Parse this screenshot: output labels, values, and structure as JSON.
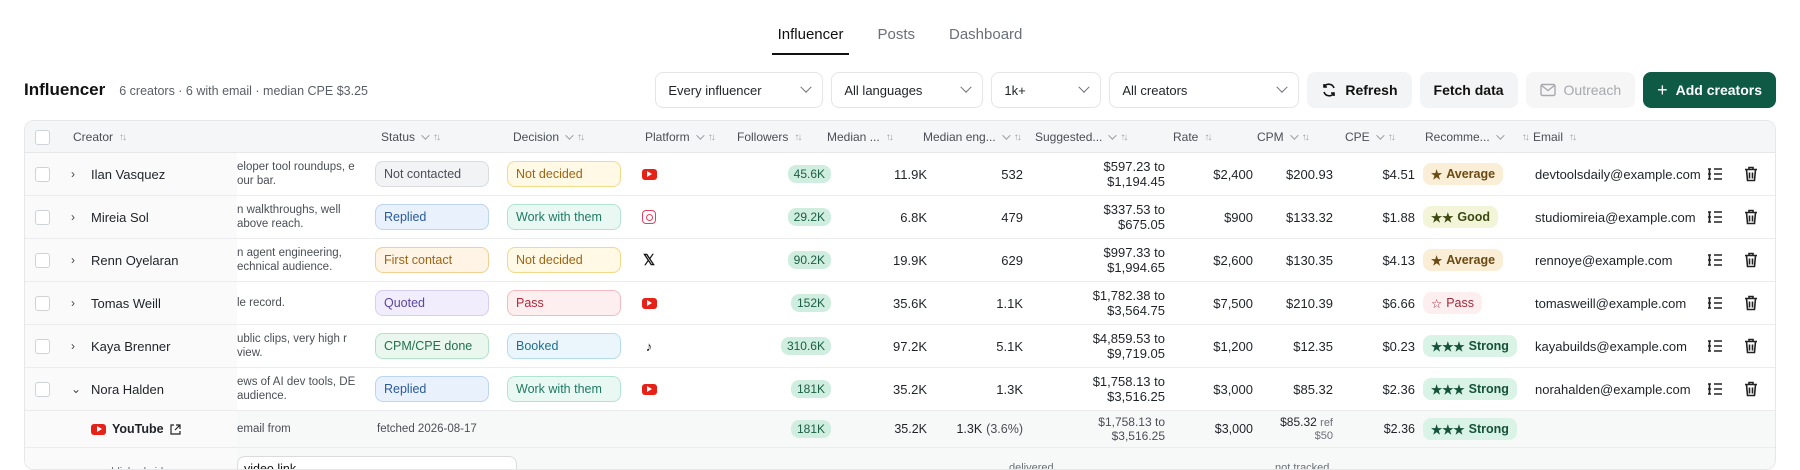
{
  "tabs": [
    {
      "label": "Influencer",
      "active": true
    },
    {
      "label": "Posts",
      "active": false
    },
    {
      "label": "Dashboard",
      "active": false
    }
  ],
  "header": {
    "title": "Influencer",
    "summary": "6 creators · 6 with email · median CPE $3.25"
  },
  "filters": {
    "influencer": "Every influencer",
    "languages": "All languages",
    "followers": "1k+",
    "creators": "All creators"
  },
  "actions": {
    "refresh": "Refresh",
    "fetch": "Fetch data",
    "outreach": "Outreach",
    "add": "Add creators"
  },
  "columns": {
    "creator": "Creator",
    "status": "Status",
    "decision": "Decision",
    "platform": "Platform",
    "followers": "Followers",
    "median_views": "Median ...",
    "median_eng": "Median eng...",
    "suggested": "Suggested...",
    "rate": "Rate",
    "cpm": "CPM",
    "cpe": "CPE",
    "recommend": "Recomme...",
    "email": "Email"
  },
  "rows": [
    {
      "name": "Ilan Vasquez",
      "notes": "eloper tool roundups, e our bar.",
      "status": "Not contacted",
      "status_style": "gray",
      "decision": "Not decided",
      "decision_style": "yellow",
      "platform": "youtube-icon",
      "followers": "45.6K",
      "median_views": "11.9K",
      "median_eng": "532",
      "suggested_1": "$597.23 to",
      "suggested_2": "$1,194.45",
      "rate": "$2,400",
      "cpm": "$200.93",
      "cpe": "$4.51",
      "rec": "Average",
      "rec_stars": "★",
      "rec_style": "average",
      "email": "devtoolsdaily@example.com",
      "expanded": false
    },
    {
      "name": "Mireia Sol",
      "notes": "n walkthroughs, well above reach.",
      "status": "Replied",
      "status_style": "blue",
      "decision": "Work with them",
      "decision_style": "teal",
      "platform": "instagram-icon",
      "followers": "29.2K",
      "median_views": "6.8K",
      "median_eng": "479",
      "suggested_1": "$337.53 to",
      "suggested_2": "$675.05",
      "rate": "$900",
      "cpm": "$133.32",
      "cpe": "$1.88",
      "rec": "Good",
      "rec_stars": "★★",
      "rec_style": "good",
      "email": "studiomireia@example.com",
      "expanded": false
    },
    {
      "name": "Renn Oyelaran",
      "notes": "n agent engineering, echnical audience.",
      "status": "First contact",
      "status_style": "orange",
      "decision": "Not decided",
      "decision_style": "yellow",
      "platform": "x-icon",
      "followers": "90.2K",
      "median_views": "19.9K",
      "median_eng": "629",
      "suggested_1": "$997.33 to",
      "suggested_2": "$1,994.65",
      "rate": "$2,600",
      "cpm": "$130.35",
      "cpe": "$4.13",
      "rec": "Average",
      "rec_stars": "★",
      "rec_style": "average",
      "email": "rennoye@example.com",
      "expanded": false
    },
    {
      "name": "Tomas Weill",
      "notes": "le record.",
      "status": "Quoted",
      "status_style": "purple",
      "decision": "Pass",
      "decision_style": "red",
      "platform": "youtube-icon",
      "followers": "152K",
      "median_views": "35.6K",
      "median_eng": "1.1K",
      "suggested_1": "$1,782.38 to",
      "suggested_2": "$3,564.75",
      "rate": "$7,500",
      "cpm": "$210.39",
      "cpe": "$6.66",
      "rec": "Pass",
      "rec_stars": "☆",
      "rec_style": "pass",
      "email": "tomasweill@example.com",
      "expanded": false
    },
    {
      "name": "Kaya Brenner",
      "notes": "ublic clips, very high r view.",
      "status": "CPM/CPE done",
      "status_style": "green",
      "decision": "Booked",
      "decision_style": "booked",
      "platform": "tiktok-icon",
      "followers": "310.6K",
      "median_views": "97.2K",
      "median_eng": "5.1K",
      "suggested_1": "$4,859.53 to",
      "suggested_2": "$9,719.05",
      "rate": "$1,200",
      "cpm": "$12.35",
      "cpe": "$0.23",
      "rec": "Strong",
      "rec_stars": "★★★",
      "rec_style": "strong",
      "email": "kayabuilds@example.com",
      "expanded": false
    },
    {
      "name": "Nora Halden",
      "notes": "ews of AI dev tools, DE audience.",
      "status": "Replied",
      "status_style": "blue",
      "decision": "Work with them",
      "decision_style": "teal",
      "platform": "youtube-icon",
      "followers": "181K",
      "median_views": "35.2K",
      "median_eng": "1.3K",
      "suggested_1": "$1,758.13 to",
      "suggested_2": "$3,516.25",
      "rate": "$3,000",
      "cpm": "$85.32",
      "cpe": "$2.36",
      "rec": "Strong",
      "rec_stars": "★★★",
      "rec_style": "strong",
      "email": "norahalden@example.com",
      "expanded": true
    }
  ],
  "subrow": {
    "platform_label": "YouTube",
    "notes": "email from",
    "fetched": "fetched 2026-08-17",
    "followers": "181K",
    "median_views": "35.2K",
    "median_eng": "1.3K",
    "median_eng_pct": "(3.6%)",
    "suggested_1": "$1,758.13 to",
    "suggested_2": "$3,516.25",
    "rate": "$3,000",
    "cpm": "$85.32",
    "cpm_ref": "ref",
    "cpm_ref_val": "$50",
    "cpe": "$2.36",
    "rec": "Strong",
    "rec_stars": "★★★"
  },
  "partial_row": {
    "left": "published video",
    "input": "video link",
    "mid": "delivered",
    "right": "not tracked"
  },
  "colors": {
    "primary": "#0f5a45",
    "youtube": "#e62117",
    "instagram": "#e4405f"
  }
}
